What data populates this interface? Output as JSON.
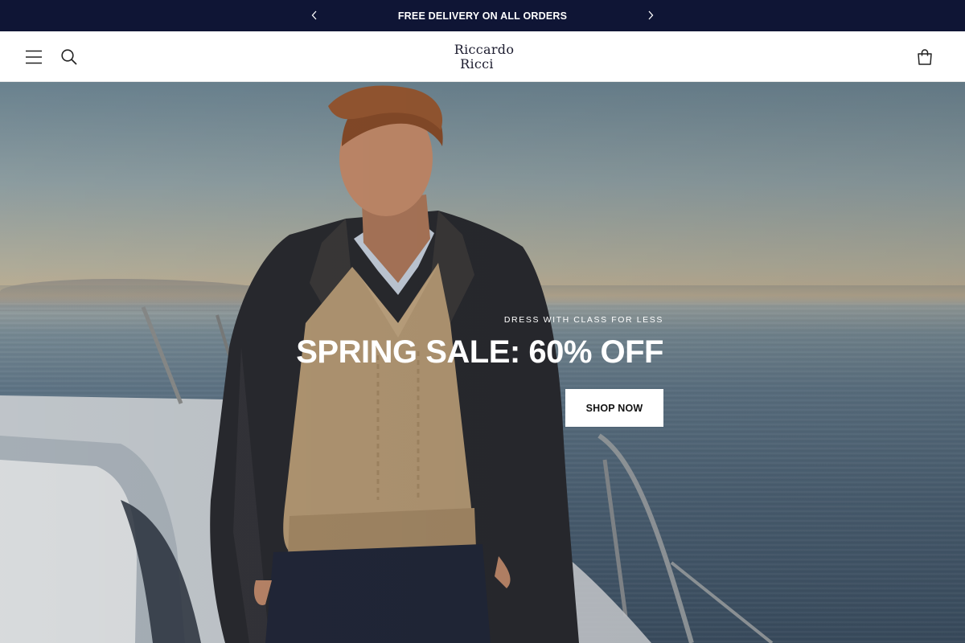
{
  "announcement": {
    "message": "FREE DELIVERY ON ALL ORDERS",
    "prev_icon": "chevron-left-icon",
    "next_icon": "chevron-right-icon",
    "background": "#0f1535"
  },
  "header": {
    "logo_line1": "Riccardo",
    "logo_line2": "Ricci",
    "menu_icon": "hamburger-menu-icon",
    "search_icon": "search-icon",
    "cart_icon": "shopping-bag-icon"
  },
  "hero": {
    "eyebrow": "DRESS WITH CLASS FOR LESS",
    "headline": "SPRING SALE: 60% OFF",
    "cta_label": "SHOP NOW"
  }
}
